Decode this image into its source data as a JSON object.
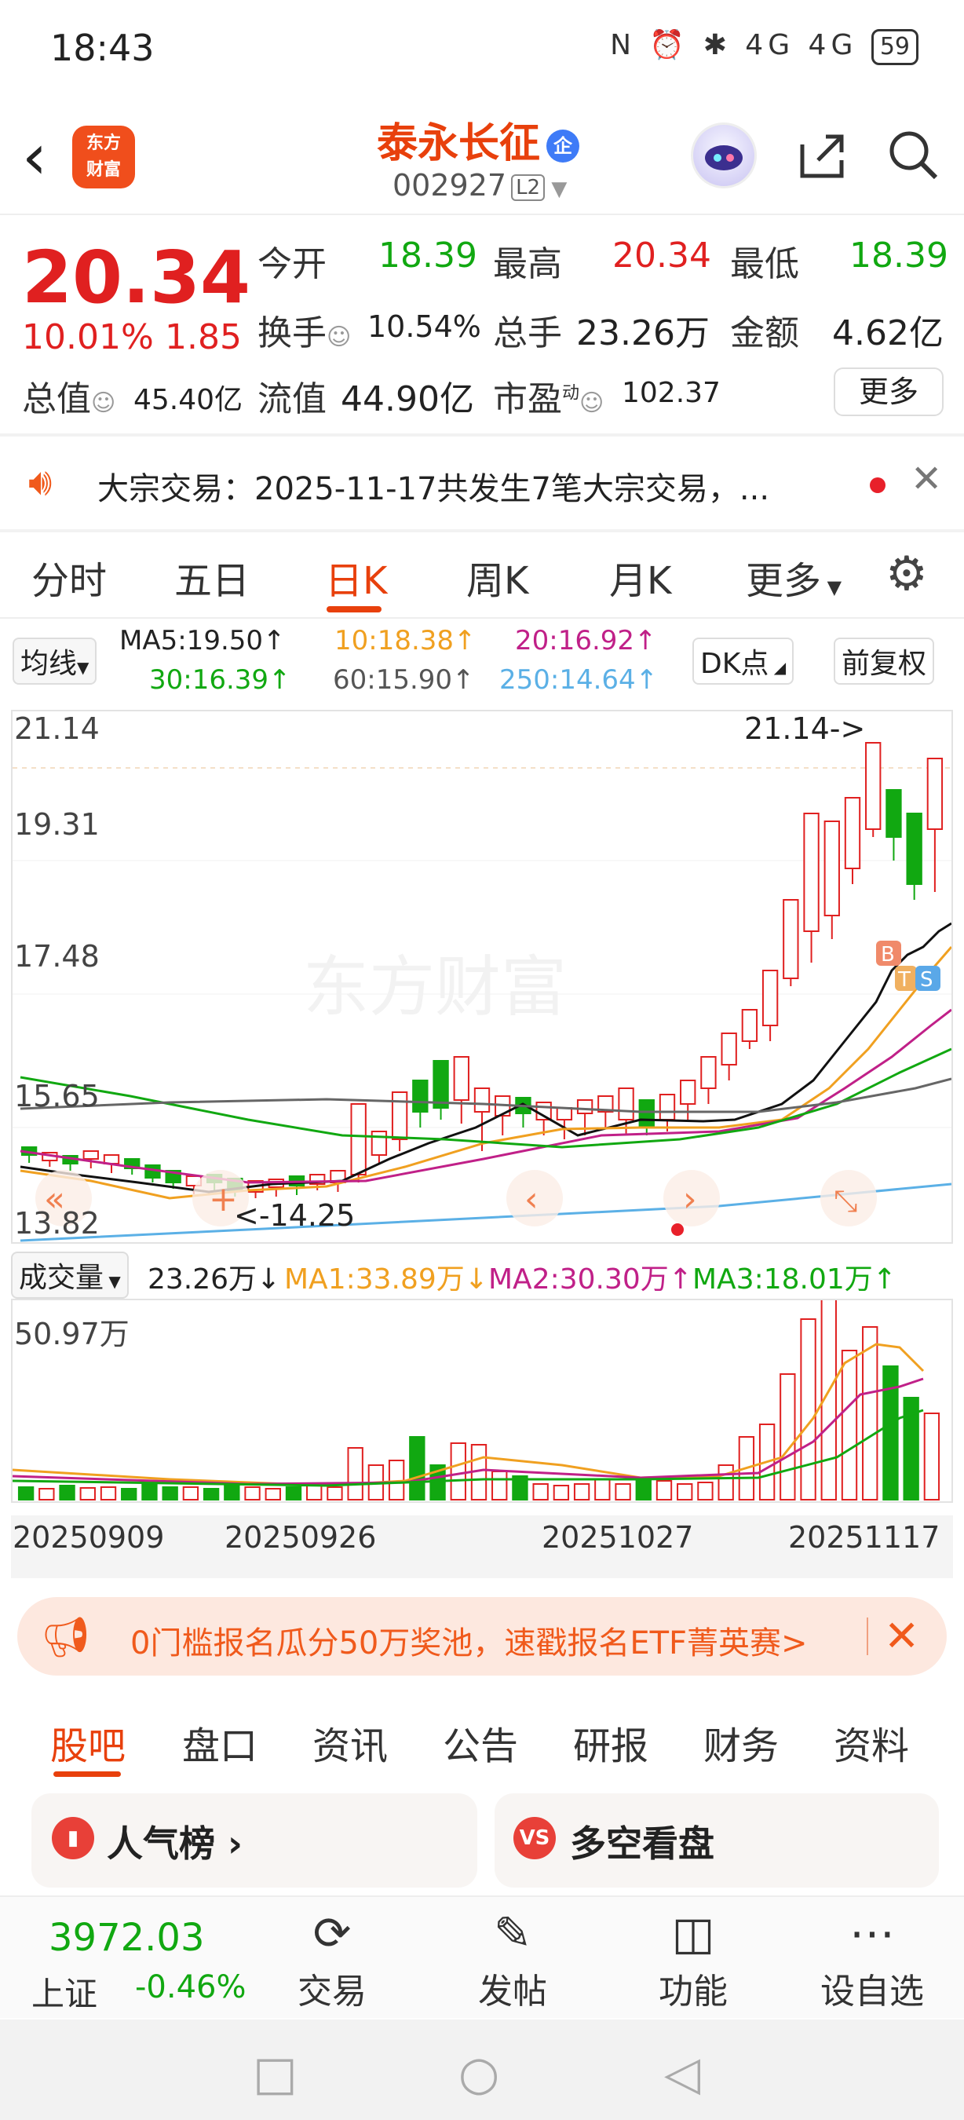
{
  "status_bar": {
    "time": "18:43",
    "icons": "N ⏰ ✱ 4G 4G",
    "battery": "59"
  },
  "header": {
    "logo_text": "东方\n财富",
    "stock_name": "泰永长征",
    "badge": "企",
    "stock_code": "002927",
    "level": "L2"
  },
  "quote": {
    "price": "20.34",
    "change_pct": "10.01%",
    "change": "1.85",
    "open_label": "今开",
    "open": "18.39",
    "high_label": "最高",
    "high": "20.34",
    "low_label": "最低",
    "low": "18.39",
    "turnover_label": "换手",
    "turnover": "10.54%",
    "volume_label": "总手",
    "volume": "23.26万",
    "amount_label": "金额",
    "amount": "4.62亿",
    "mcap_label": "总值",
    "mcap": "45.40亿",
    "float_label": "流值",
    "float_val": "44.90亿",
    "pe_label": "市盈",
    "pe_sup": "动",
    "pe": "102.37",
    "more": "更多"
  },
  "notice": {
    "text": "大宗交易：2025-11-17共发生7笔大宗交易，..."
  },
  "period_tabs": [
    "分时",
    "五日",
    "日K",
    "周K",
    "月K",
    "更多"
  ],
  "active_tab": "日K",
  "ma_bar": {
    "selector": "均线",
    "ma5": "MA5:19.50↑",
    "ma10": "10:18.38↑",
    "ma20": "20:16.92↑",
    "ma30": "30:16.39↑",
    "ma60": "60:15.90↑",
    "ma250": "250:14.64↑",
    "dk": "DK点",
    "adjust": "前复权"
  },
  "kline": {
    "y_ticks": [
      "21.14",
      "19.31",
      "17.48",
      "15.65",
      "13.82"
    ],
    "high_note": "21.14->",
    "low_note": "<-14.25",
    "watermark": "东方财富",
    "markers": [
      "B",
      "T",
      "S"
    ]
  },
  "volume_bar": {
    "selector": "成交量",
    "vol": "23.26万↓",
    "ma1": "MA1:33.89万↓",
    "ma2": "MA2:30.30万↑",
    "ma3": "MA3:18.01万↑",
    "y_top": "50.97万"
  },
  "dates": [
    "20250909",
    "20250926",
    "20251027",
    "20251117"
  ],
  "banner": {
    "text": "0门槛报名瓜分50万奖池，速戳报名ETF菁英赛>"
  },
  "sub_tabs": [
    "股吧",
    "盘口",
    "资讯",
    "公告",
    "研报",
    "财务",
    "资料"
  ],
  "cards": [
    {
      "icon": "▮",
      "title": "人气榜 ›"
    },
    {
      "icon": "VS",
      "title": "多空看盘"
    }
  ],
  "bottom_nav": {
    "index_value": "3972.03",
    "index_name": "上证",
    "index_change": "-0.46%",
    "items": [
      "交易",
      "发帖",
      "功能",
      "设自选"
    ]
  },
  "colors": {
    "up": "#e02020",
    "down": "#11a811",
    "accent": "#e8400c"
  }
}
